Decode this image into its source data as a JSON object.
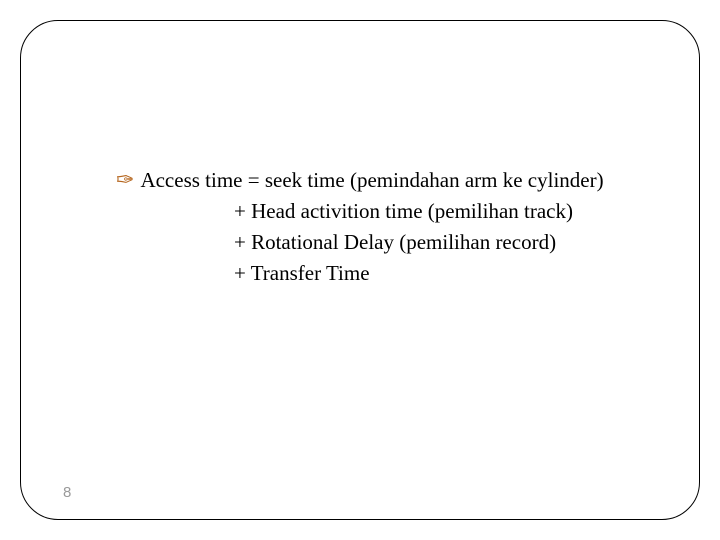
{
  "slide": {
    "bullet_glyph": "✑",
    "line1": "Access time = seek time (pemindahan arm ke cylinder)",
    "line2": "+ Head activition time (pemilihan track)",
    "line3": "+ Rotational Delay (pemilihan record)",
    "line4": "+ Transfer Time",
    "page_number": "8"
  }
}
